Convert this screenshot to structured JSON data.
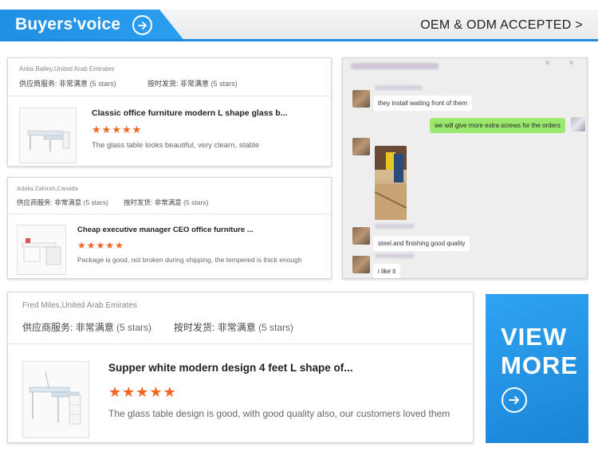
{
  "header": {
    "title": "Buyers'voice",
    "right_link": "OEM & ODM ACCEPTED >"
  },
  "reviews": [
    {
      "author": "Anita Bailey,United Arab Emirates",
      "service_label": "供应商服务:",
      "service_value": "非常满意",
      "service_stars": "(5 stars)",
      "delivery_label": "按时发货:",
      "delivery_value": "非常满意",
      "delivery_stars": "(5 stars)",
      "product_title": "Classic office furniture modern L shape glass b...",
      "rating": 5,
      "comment": "The glass table looks beautiful, very clearn, stable"
    },
    {
      "author": "Adalia Zahirah,Canada",
      "service_label": "供应商服务:",
      "service_value": "非常满意",
      "service_stars": "(5 stars)",
      "delivery_label": "按时发货:",
      "delivery_value": "非常满意",
      "delivery_stars": "(5 stars)",
      "product_title": "Cheap executive manager CEO office furniture ...",
      "rating": 5,
      "comment": "Package is good, not broken during shipping, the tempered is thick enough"
    },
    {
      "author": "Fred Miles,United Arab Emirates",
      "service_label": "供应商服务:",
      "service_value": "非常满意",
      "service_stars": "(5 stars)",
      "delivery_label": "按时发货:",
      "delivery_value": "非常满意",
      "delivery_stars": "(5 stars)",
      "product_title": "Supper white modern design 4 feet L shape of...",
      "rating": 5,
      "comment": "The glass table design is good, with good quality also, our customers loved them"
    }
  ],
  "chat": {
    "messages": [
      {
        "side": "left",
        "text": "they install waiting front of them"
      },
      {
        "side": "right",
        "text": "we will give more extra screws for the orders"
      },
      {
        "side": "left",
        "text": "steel.and finishing good quality"
      },
      {
        "side": "left",
        "text": "i like it"
      }
    ]
  },
  "view_more": {
    "line1": "VIEW",
    "line2": "MORE"
  },
  "colors": {
    "brand_blue": "#1f8fe2",
    "star_orange": "#f26522",
    "chat_green": "#9be86e"
  },
  "icons": [
    "arrow-right-circle-icon",
    "star-icon",
    "desk-product-image"
  ]
}
